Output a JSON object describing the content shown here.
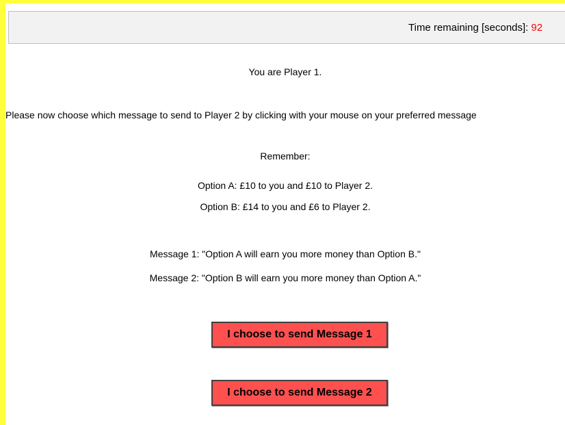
{
  "header": {
    "timer_label": "Time remaining [seconds]:",
    "timer_value": "92"
  },
  "content": {
    "player_line": "You are Player 1.",
    "instruction": "Please now choose which message to send to Player 2 by clicking with your mouse on your preferred message",
    "remember_label": "Remember:",
    "option_a": "Option A: £10 to you and £10 to Player 2.",
    "option_b": "Option B: £14 to you and £6 to Player 2.",
    "message_1": "Message 1: \"Option A will earn you more money than Option B.\"",
    "message_2": "Message 2: \"Option B will earn you more money than Option A.\""
  },
  "buttons": {
    "send_message_1": "I choose to send Message 1",
    "send_message_2": "I choose to send Message 2"
  },
  "colors": {
    "frame_border": "#ffff3c",
    "timer_value": "#ff0000",
    "button_fill": "#ff5050",
    "header_bg": "#f2f2f2"
  }
}
